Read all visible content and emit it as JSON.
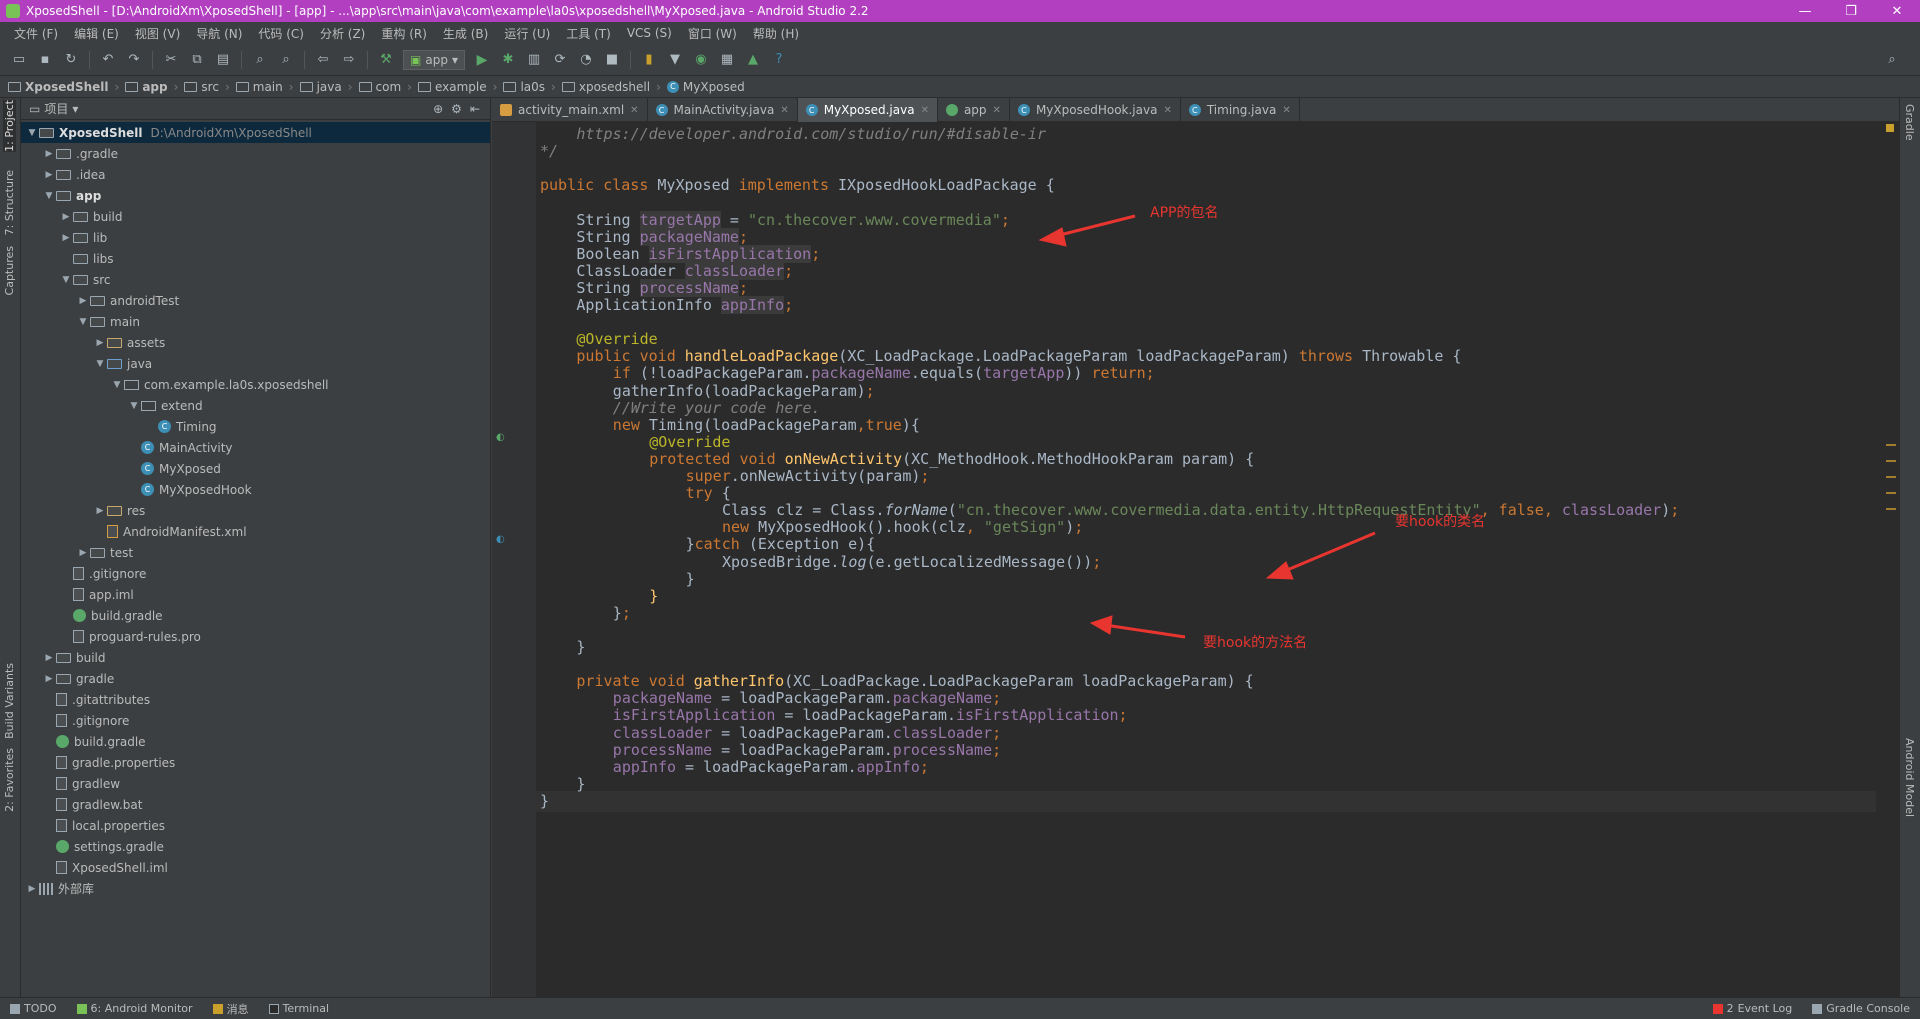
{
  "window": {
    "title": "XposedShell - [D:\\AndroidXm\\XposedShell] - [app] - ...\\app\\src\\main\\java\\com\\example\\la0s\\xposedshell\\MyXposed.java - Android Studio 2.2",
    "minimize": "—",
    "maximize": "❐",
    "close": "✕"
  },
  "menu": [
    "文件 (F)",
    "编辑 (E)",
    "视图 (V)",
    "导航 (N)",
    "代码 (C)",
    "分析 (Z)",
    "重构 (R)",
    "生成 (B)",
    "运行 (U)",
    "工具 (T)",
    "VCS (S)",
    "窗口 (W)",
    "帮助 (H)"
  ],
  "toolbar": {
    "run_config": "app"
  },
  "breadcrumb": [
    "XposedShell",
    "app",
    "src",
    "main",
    "java",
    "com",
    "example",
    "la0s",
    "xposedshell",
    "MyXposed"
  ],
  "left_tool_tabs": [
    "1: Project",
    "7: Structure",
    "Captures",
    "Build Variants",
    "2: Favorites"
  ],
  "right_tool_tabs": [
    "Gradle",
    "Android Model"
  ],
  "project_panel": {
    "view_label": "项目",
    "root_name": "XposedShell",
    "root_path": "D:\\AndroidXm\\XposedShell",
    "tree": [
      {
        "label": "XposedShell",
        "level": 0,
        "arrow": "open",
        "icon": "folder",
        "bold": true
      },
      {
        "label": ".gradle",
        "level": 1,
        "arrow": "closed",
        "icon": "folder"
      },
      {
        "label": ".idea",
        "level": 1,
        "arrow": "closed",
        "icon": "folder"
      },
      {
        "label": "app",
        "level": 1,
        "arrow": "open",
        "icon": "folder",
        "bold": true
      },
      {
        "label": "build",
        "level": 2,
        "arrow": "closed",
        "icon": "folder"
      },
      {
        "label": "lib",
        "level": 2,
        "arrow": "closed",
        "icon": "folder"
      },
      {
        "label": "libs",
        "level": 2,
        "arrow": "none",
        "icon": "folder"
      },
      {
        "label": "src",
        "level": 2,
        "arrow": "open",
        "icon": "folder"
      },
      {
        "label": "androidTest",
        "level": 3,
        "arrow": "closed",
        "icon": "folder"
      },
      {
        "label": "main",
        "level": 3,
        "arrow": "open",
        "icon": "folder"
      },
      {
        "label": "assets",
        "level": 4,
        "arrow": "closed",
        "icon": "folder-res"
      },
      {
        "label": "java",
        "level": 4,
        "arrow": "open",
        "icon": "folder-src"
      },
      {
        "label": "com.example.la0s.xposedshell",
        "level": 5,
        "arrow": "open",
        "icon": "pkg"
      },
      {
        "label": "extend",
        "level": 6,
        "arrow": "open",
        "icon": "pkg"
      },
      {
        "label": "Timing",
        "level": 7,
        "arrow": "none",
        "icon": "class"
      },
      {
        "label": "MainActivity",
        "level": 6,
        "arrow": "none",
        "icon": "class"
      },
      {
        "label": "MyXposed",
        "level": 6,
        "arrow": "none",
        "icon": "class"
      },
      {
        "label": "MyXposedHook",
        "level": 6,
        "arrow": "none",
        "icon": "class"
      },
      {
        "label": "res",
        "level": 4,
        "arrow": "closed",
        "icon": "folder-res"
      },
      {
        "label": "AndroidManifest.xml",
        "level": 4,
        "arrow": "none",
        "icon": "xml"
      },
      {
        "label": "test",
        "level": 3,
        "arrow": "closed",
        "icon": "folder"
      },
      {
        "label": ".gitignore",
        "level": 2,
        "arrow": "none",
        "icon": "file"
      },
      {
        "label": "app.iml",
        "level": 2,
        "arrow": "none",
        "icon": "file"
      },
      {
        "label": "build.gradle",
        "level": 2,
        "arrow": "none",
        "icon": "gradle"
      },
      {
        "label": "proguard-rules.pro",
        "level": 2,
        "arrow": "none",
        "icon": "file"
      },
      {
        "label": "build",
        "level": 1,
        "arrow": "closed",
        "icon": "folder"
      },
      {
        "label": "gradle",
        "level": 1,
        "arrow": "closed",
        "icon": "folder"
      },
      {
        "label": ".gitattributes",
        "level": 1,
        "arrow": "none",
        "icon": "file"
      },
      {
        "label": ".gitignore",
        "level": 1,
        "arrow": "none",
        "icon": "file"
      },
      {
        "label": "build.gradle",
        "level": 1,
        "arrow": "none",
        "icon": "gradle"
      },
      {
        "label": "gradle.properties",
        "level": 1,
        "arrow": "none",
        "icon": "file"
      },
      {
        "label": "gradlew",
        "level": 1,
        "arrow": "none",
        "icon": "file"
      },
      {
        "label": "gradlew.bat",
        "level": 1,
        "arrow": "none",
        "icon": "file"
      },
      {
        "label": "local.properties",
        "level": 1,
        "arrow": "none",
        "icon": "file"
      },
      {
        "label": "settings.gradle",
        "level": 1,
        "arrow": "none",
        "icon": "gradle"
      },
      {
        "label": "XposedShell.iml",
        "level": 1,
        "arrow": "none",
        "icon": "file"
      },
      {
        "label": "外部库",
        "level": 0,
        "arrow": "closed",
        "icon": "lib"
      }
    ]
  },
  "editor": {
    "tabs": [
      {
        "label": "activity_main.xml",
        "icon": "xml",
        "active": false
      },
      {
        "label": "MainActivity.java",
        "icon": "class",
        "active": false
      },
      {
        "label": "MyXposed.java",
        "icon": "class",
        "active": true
      },
      {
        "label": "app",
        "icon": "gradle",
        "active": false
      },
      {
        "label": "MyXposedHook.java",
        "icon": "class",
        "active": false
      },
      {
        "label": "Timing.java",
        "icon": "class",
        "active": false
      }
    ],
    "code": [
      {
        "i": 4,
        "t": [
          [
            "cmt",
            "https://developer.android.com/studio/run/#disable-ir"
          ]
        ]
      },
      {
        "i": 0,
        "t": [
          [
            "cmt",
            "*/"
          ]
        ]
      },
      {
        "i": 0,
        "t": []
      },
      {
        "i": 0,
        "t": [
          [
            "kw",
            "public class "
          ],
          [
            "",
            "MyXposed "
          ],
          [
            "kw",
            "implements "
          ],
          [
            "",
            "IXposedHookLoadPackage {"
          ]
        ]
      },
      {
        "i": 0,
        "t": []
      },
      {
        "i": 4,
        "t": [
          [
            "",
            "String "
          ],
          [
            "fld hl",
            "targetApp"
          ],
          [
            "",
            " = "
          ],
          [
            "str",
            "\"cn.thecover.www.covermedia\""
          ],
          [
            "kw",
            ";"
          ]
        ]
      },
      {
        "i": 4,
        "t": [
          [
            "",
            "String "
          ],
          [
            "fld hl",
            "packageName"
          ],
          [
            "kw",
            ";"
          ]
        ]
      },
      {
        "i": 4,
        "t": [
          [
            "",
            "Boolean "
          ],
          [
            "fld hl",
            "isFirstApplication"
          ],
          [
            "kw",
            ";"
          ]
        ]
      },
      {
        "i": 4,
        "t": [
          [
            "",
            "ClassLoader "
          ],
          [
            "fld hl",
            "classLoader"
          ],
          [
            "kw",
            ";"
          ]
        ]
      },
      {
        "i": 4,
        "t": [
          [
            "",
            "String "
          ],
          [
            "fld hl",
            "processName"
          ],
          [
            "kw",
            ";"
          ]
        ]
      },
      {
        "i": 4,
        "t": [
          [
            "",
            "ApplicationInfo "
          ],
          [
            "fld hl",
            "appInfo"
          ],
          [
            "kw",
            ";"
          ]
        ]
      },
      {
        "i": 0,
        "t": []
      },
      {
        "i": 4,
        "t": [
          [
            "ann",
            "@Override"
          ]
        ]
      },
      {
        "i": 4,
        "t": [
          [
            "kw",
            "public void "
          ],
          [
            "fn",
            "handleLoadPackage"
          ],
          [
            "",
            "(XC_LoadPackage.LoadPackageParam loadPackageParam) "
          ],
          [
            "kw",
            "throws "
          ],
          [
            "",
            "Throwable {"
          ]
        ]
      },
      {
        "i": 8,
        "t": [
          [
            "kw",
            "if "
          ],
          [
            "",
            "(!loadPackageParam."
          ],
          [
            "fld",
            "packageName"
          ],
          [
            "",
            ".equals("
          ],
          [
            "fld",
            "targetApp"
          ],
          [
            "",
            ")) "
          ],
          [
            "kw",
            "return;"
          ]
        ]
      },
      {
        "i": 8,
        "t": [
          [
            "",
            "gatherInfo(loadPackageParam)"
          ],
          [
            "kw",
            ";"
          ]
        ]
      },
      {
        "i": 8,
        "t": [
          [
            "cmt",
            "//Write your code here."
          ]
        ]
      },
      {
        "i": 8,
        "t": [
          [
            "kw",
            "new "
          ],
          [
            "",
            "Timing(loadPackageParam"
          ],
          [
            "kw",
            ",true"
          ],
          [
            "",
            "){"
          ]
        ]
      },
      {
        "i": 12,
        "t": [
          [
            "ann",
            "@Override"
          ]
        ]
      },
      {
        "i": 12,
        "t": [
          [
            "kw",
            "protected void "
          ],
          [
            "fn",
            "onNewActivity"
          ],
          [
            "",
            "(XC_MethodHook.MethodHookParam param) {"
          ]
        ]
      },
      {
        "i": 16,
        "t": [
          [
            "kw",
            "super"
          ],
          [
            "",
            ".onNewActivity(param)"
          ],
          [
            "kw",
            ";"
          ]
        ]
      },
      {
        "i": 16,
        "t": [
          [
            "kw",
            "try "
          ],
          [
            "",
            "{"
          ]
        ]
      },
      {
        "i": 20,
        "t": [
          [
            "",
            "Class clz = Class."
          ],
          [
            "ital",
            "forName"
          ],
          [
            "",
            "("
          ],
          [
            "str",
            "\"cn.thecover.www.covermedia.data.entity.HttpRequestEntity\""
          ],
          [
            "kw",
            ", false, "
          ],
          [
            "fld",
            "classLoader"
          ],
          [
            "",
            ")"
          ],
          [
            "kw",
            ";"
          ]
        ]
      },
      {
        "i": 20,
        "t": [
          [
            "kw",
            "new "
          ],
          [
            "",
            "MyXposedHook().hook(clz"
          ],
          [
            "kw",
            ", "
          ],
          [
            "str",
            "\"getSign\""
          ],
          [
            "",
            ")"
          ],
          [
            "kw",
            ";"
          ]
        ]
      },
      {
        "i": 16,
        "t": [
          [
            "",
            "}"
          ],
          [
            "kw",
            "catch "
          ],
          [
            "",
            "(Exception e){"
          ]
        ]
      },
      {
        "i": 20,
        "t": [
          [
            "",
            "XposedBridge."
          ],
          [
            "ital",
            "log"
          ],
          [
            "",
            "(e.getLocalizedMessage())"
          ],
          [
            "kw",
            ";"
          ]
        ]
      },
      {
        "i": 16,
        "t": [
          [
            "",
            "}"
          ]
        ]
      },
      {
        "i": 12,
        "t": [
          [
            "fn",
            "}"
          ]
        ]
      },
      {
        "i": 8,
        "t": [
          [
            "",
            "}"
          ],
          [
            "kw",
            ";"
          ]
        ]
      },
      {
        "i": 0,
        "t": []
      },
      {
        "i": 4,
        "t": [
          [
            "",
            "}"
          ]
        ]
      },
      {
        "i": 0,
        "t": []
      },
      {
        "i": 4,
        "t": [
          [
            "kw",
            "private void "
          ],
          [
            "fn",
            "gatherInfo"
          ],
          [
            "",
            "(XC_LoadPackage.LoadPackageParam loadPackageParam) {"
          ]
        ]
      },
      {
        "i": 8,
        "t": [
          [
            "fld",
            "packageName"
          ],
          [
            "",
            " = loadPackageParam."
          ],
          [
            "fld",
            "packageName"
          ],
          [
            "kw",
            ";"
          ]
        ]
      },
      {
        "i": 8,
        "t": [
          [
            "fld",
            "isFirstApplication"
          ],
          [
            "",
            " = loadPackageParam."
          ],
          [
            "fld",
            "isFirstApplication"
          ],
          [
            "kw",
            ";"
          ]
        ]
      },
      {
        "i": 8,
        "t": [
          [
            "fld",
            "classLoader"
          ],
          [
            "",
            " = loadPackageParam."
          ],
          [
            "fld",
            "classLoader"
          ],
          [
            "kw",
            ";"
          ]
        ]
      },
      {
        "i": 8,
        "t": [
          [
            "fld",
            "processName"
          ],
          [
            "",
            " = loadPackageParam."
          ],
          [
            "fld",
            "processName"
          ],
          [
            "kw",
            ";"
          ]
        ]
      },
      {
        "i": 8,
        "t": [
          [
            "fld",
            "appInfo"
          ],
          [
            "",
            " = loadPackageParam."
          ],
          [
            "fld",
            "appInfo"
          ],
          [
            "kw",
            ";"
          ]
        ]
      },
      {
        "i": 4,
        "t": [
          [
            "",
            "}"
          ]
        ]
      },
      {
        "i": 0,
        "t": [
          [
            "",
            "}"
          ]
        ]
      }
    ]
  },
  "annotations": {
    "app_package": "APP的包名",
    "hook_class": "要hook的类名",
    "hook_method": "要hook的方法名"
  },
  "statusbar": {
    "todo": "TODO",
    "android_monitor": "6: Android Monitor",
    "messages": "消息",
    "terminal": "Terminal",
    "event_log": "Event Log",
    "event_count": "2",
    "gradle_console": "Gradle Console"
  },
  "colors": {
    "titlebar": "#b13fbf",
    "editor_bg": "#2b2b2b",
    "annotation": "#e8352f"
  }
}
